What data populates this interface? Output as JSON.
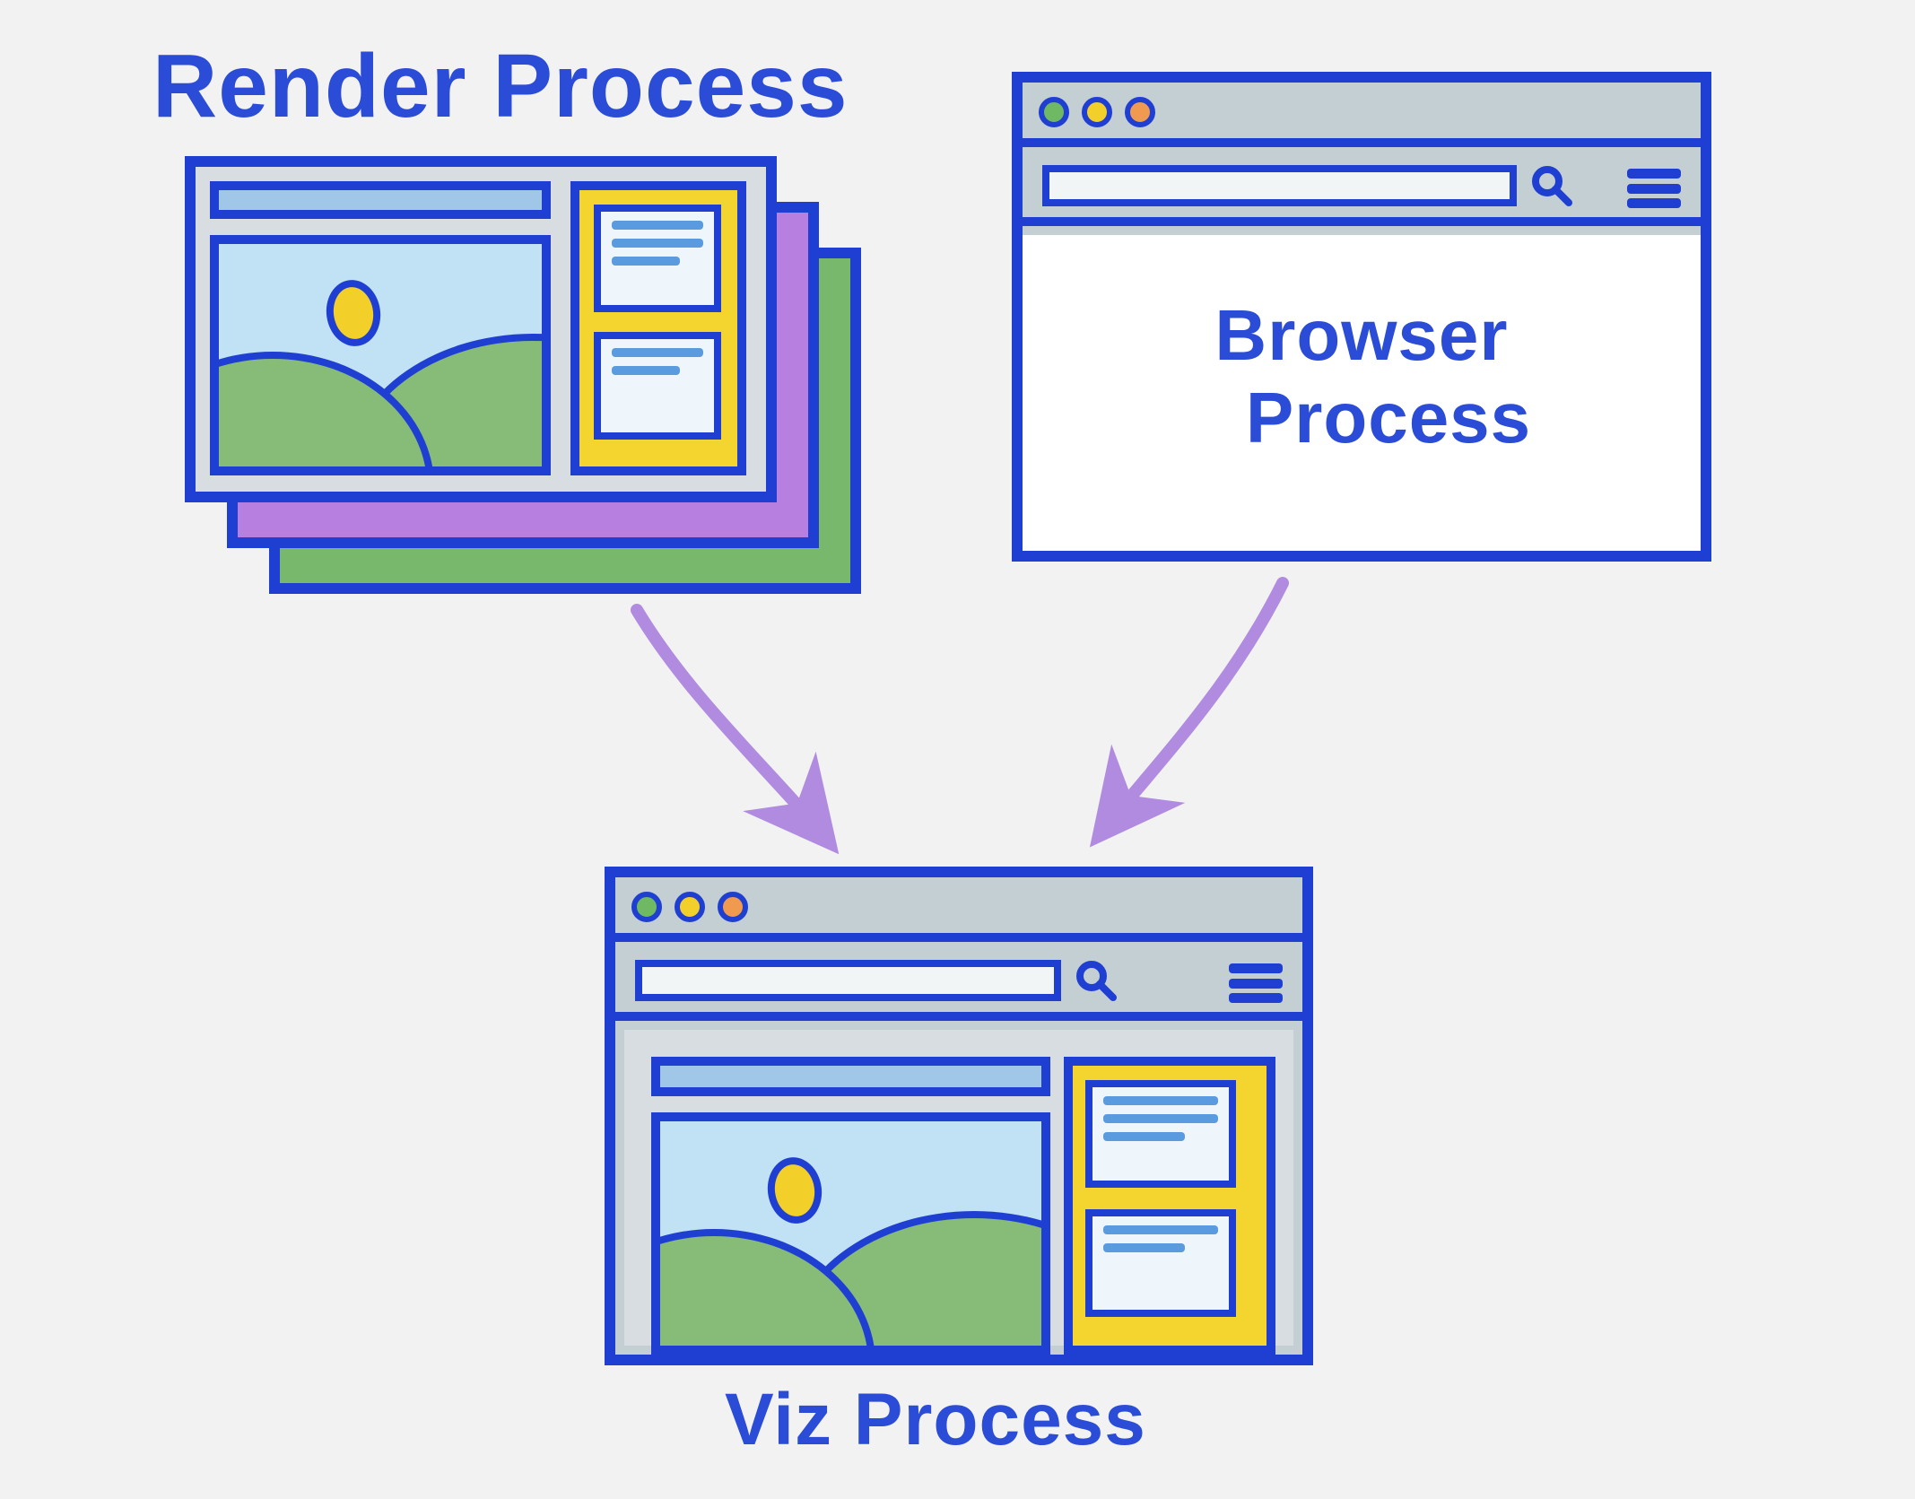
{
  "labels": {
    "render": "Render Process",
    "browser_line1": "Browser",
    "browser_line2": "Process",
    "viz": "Viz Process"
  },
  "nodes": [
    "Render Process",
    "Browser Process",
    "Viz Process"
  ],
  "edges": [
    {
      "from": "Render Process",
      "to": "Viz Process"
    },
    {
      "from": "Browser Process",
      "to": "Viz Process"
    }
  ],
  "colors": {
    "stroke": "#1f3fd2",
    "text": "#2a4cd6",
    "arrow": "#b08be0",
    "green": "#78b86d",
    "purple": "#b67fe0",
    "yellow": "#f3cf2a",
    "sky": "#c1e1f4",
    "grass": "#87bb78",
    "chrome": "#c3cfd3"
  },
  "icons": {
    "search": "search-icon",
    "menu": "hamburger-icon",
    "traffic_lights": [
      "green",
      "yellow",
      "orange"
    ]
  }
}
